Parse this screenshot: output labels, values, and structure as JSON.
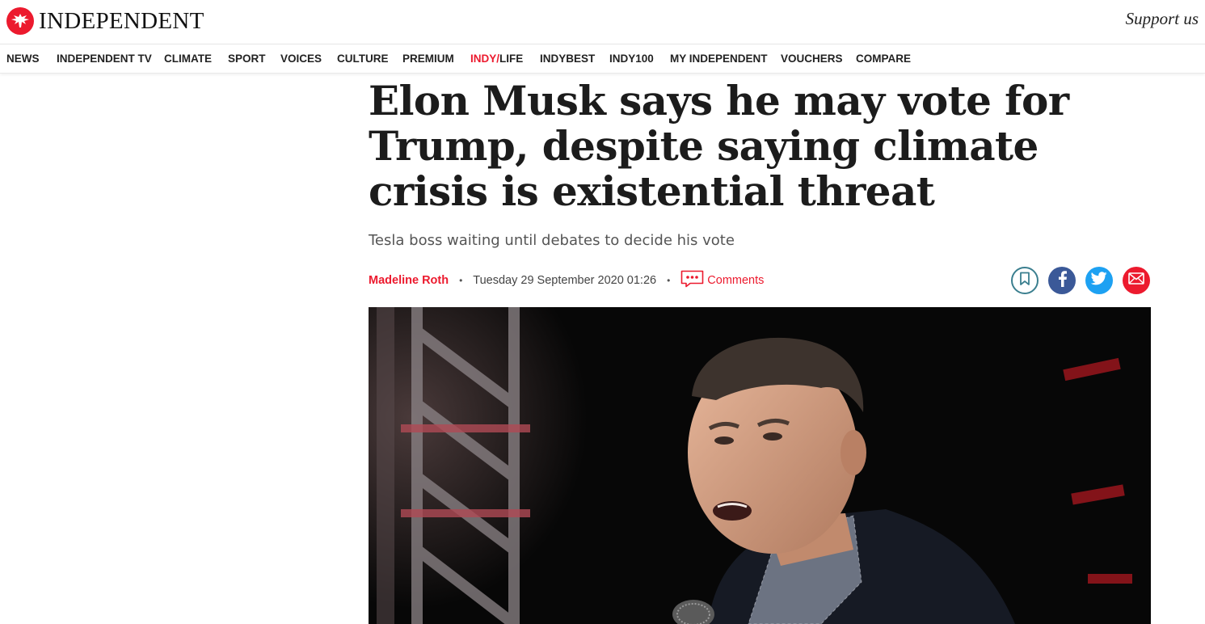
{
  "header": {
    "logo_text": "INDEPENDENT",
    "support_label": "Support us"
  },
  "nav": {
    "items": [
      {
        "label": "NEWS"
      },
      {
        "label": "INDEPENDENT TV"
      },
      {
        "label": "CLIMATE"
      },
      {
        "label": "SPORT"
      },
      {
        "label": "VOICES"
      },
      {
        "label": "CULTURE"
      },
      {
        "label": "PREMIUM"
      },
      {
        "label_accent": "INDY/",
        "label_rest": "LIFE"
      },
      {
        "label": "INDYBEST"
      },
      {
        "label": "INDY100"
      },
      {
        "label": "MY INDEPENDENT"
      },
      {
        "label": "VOUCHERS"
      },
      {
        "label": "COMPARE"
      }
    ]
  },
  "article": {
    "headline": "Elon Musk says he may vote for Trump, despite saying climate crisis is existential threat",
    "standfirst": "Tesla boss waiting until debates to decide his vote",
    "author": "Madeline Roth",
    "date": "Tuesday 29 September 2020 01:26",
    "comments_label": "Comments"
  },
  "share": {
    "icons": [
      "bookmark-icon",
      "facebook-icon",
      "twitter-icon",
      "email-icon"
    ]
  },
  "colors": {
    "brand_red": "#ec1a2e",
    "facebook": "#3b5998",
    "twitter": "#1da1f2",
    "bookmark": "#3b7f8f"
  },
  "hero_image": {
    "subject": "photo-of-speaker"
  }
}
